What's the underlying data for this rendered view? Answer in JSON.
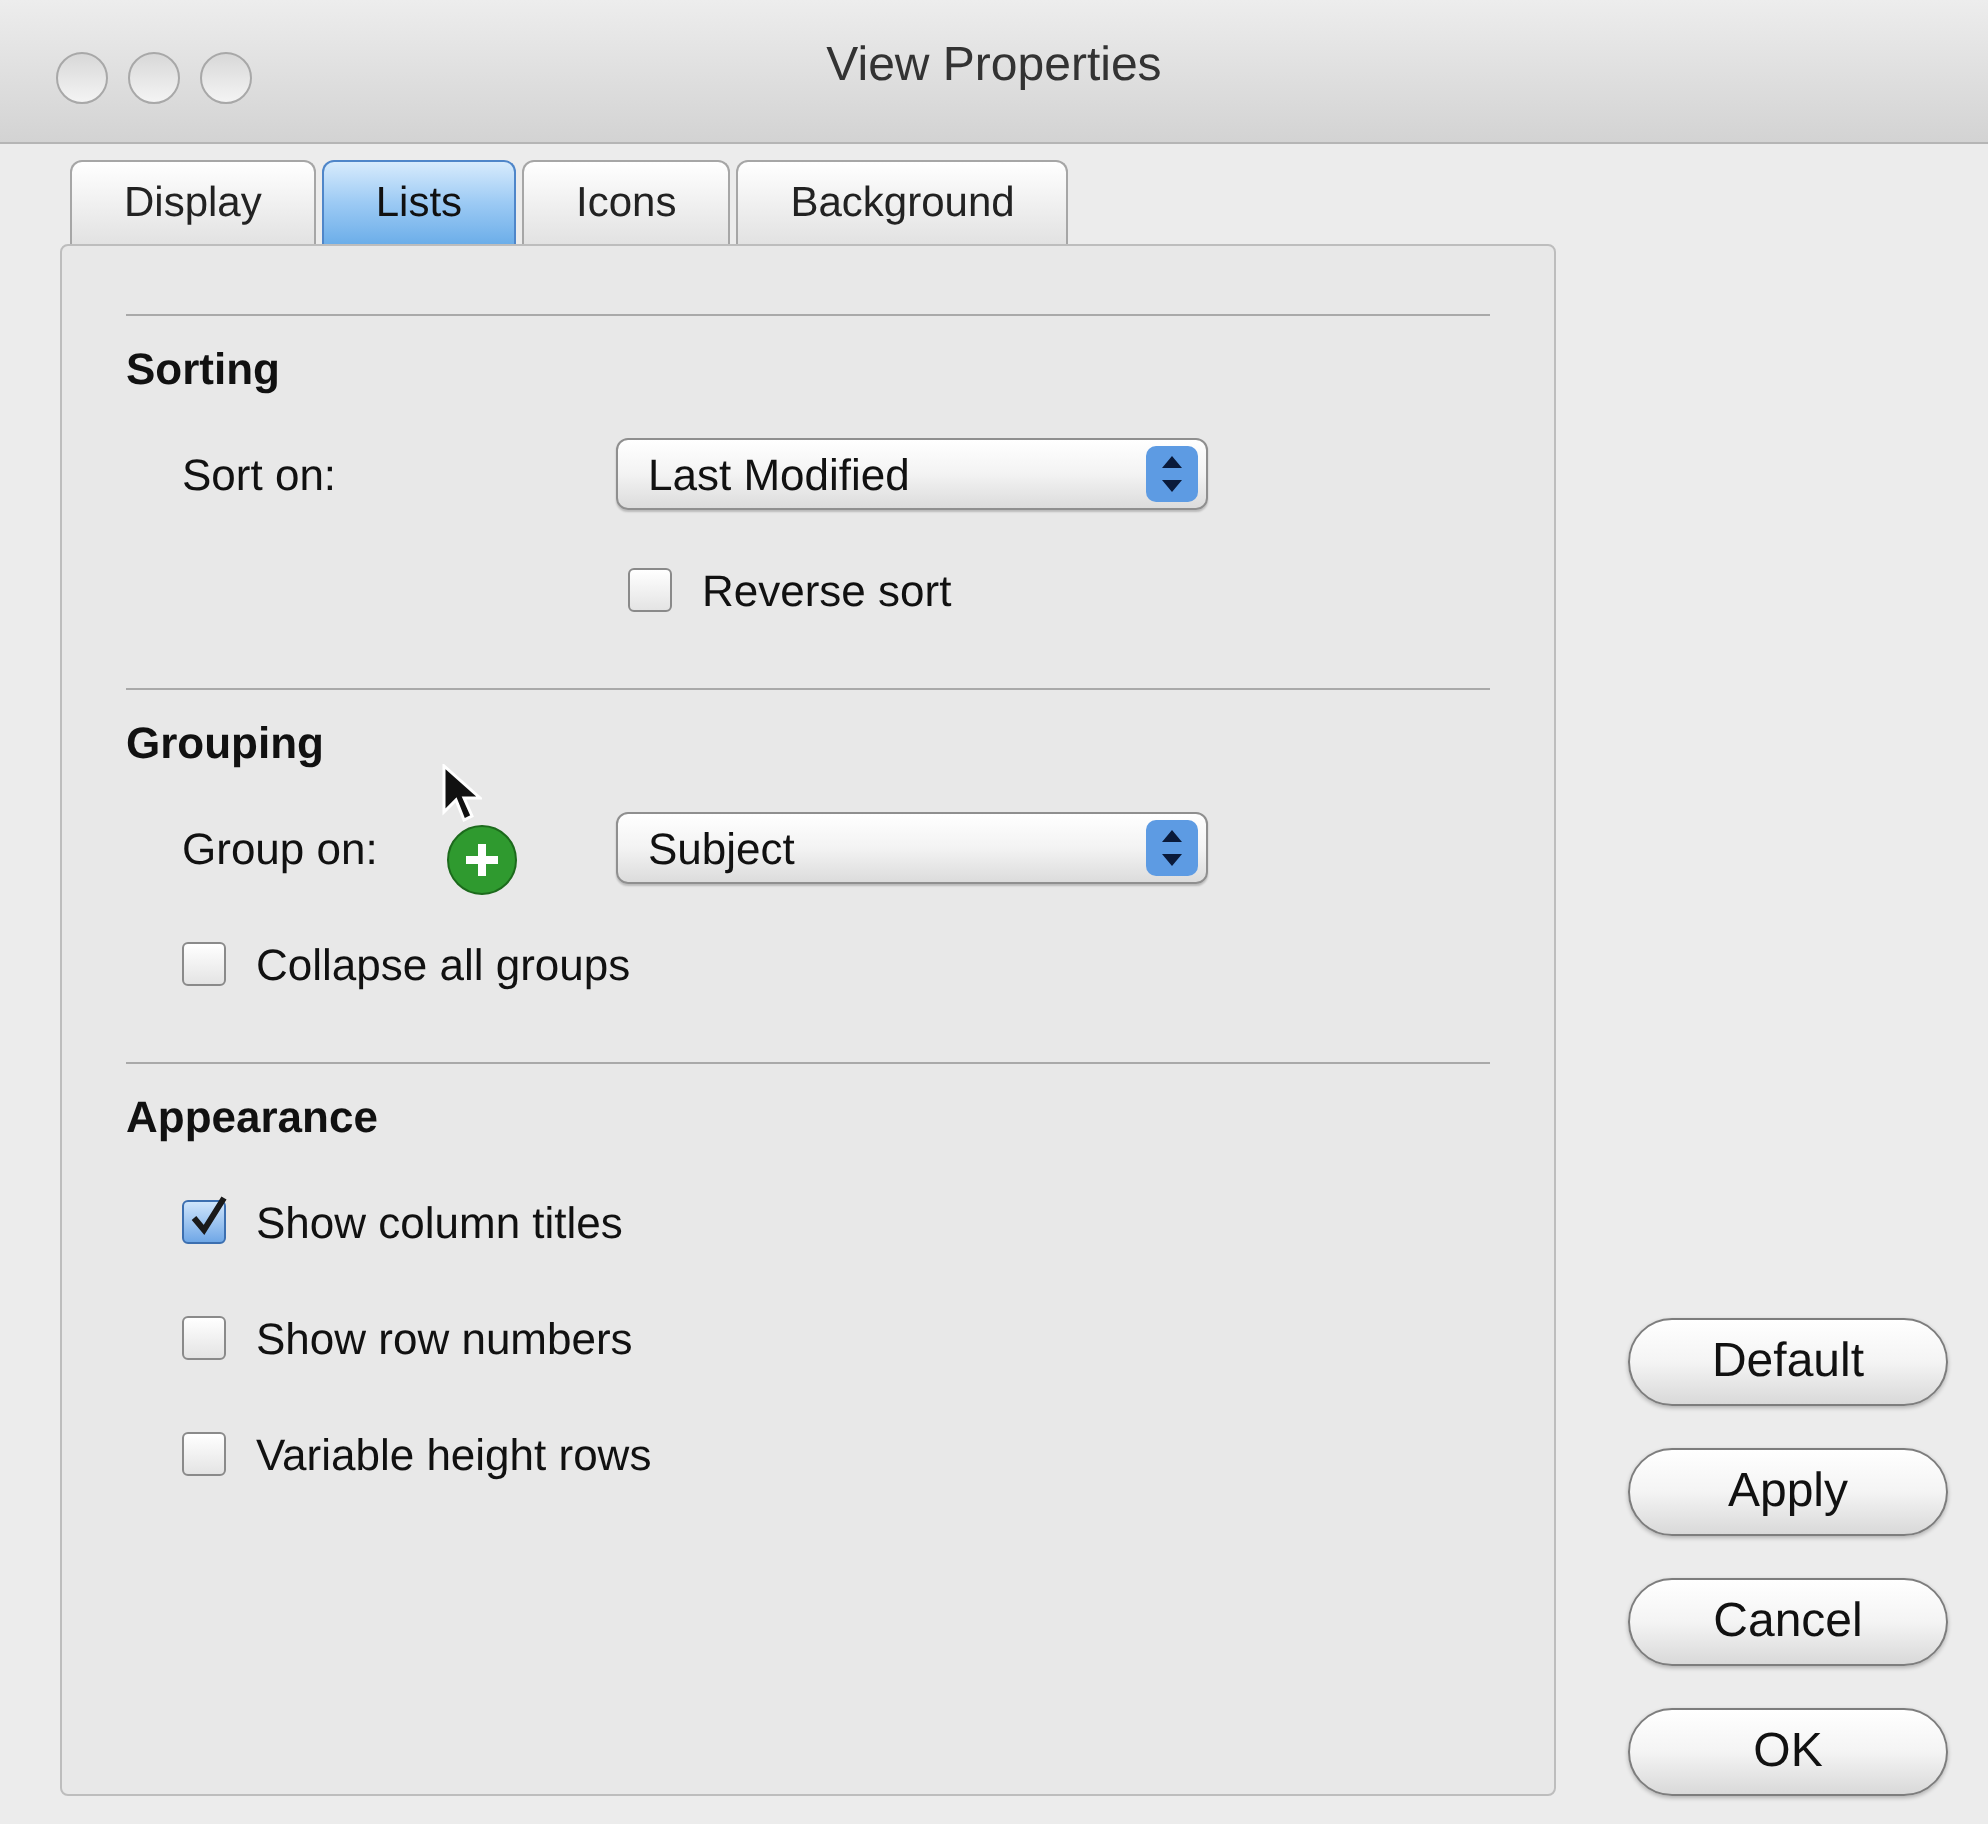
{
  "window": {
    "title": "View Properties"
  },
  "tabs": [
    {
      "label": "Display",
      "selected": false
    },
    {
      "label": "Lists",
      "selected": true
    },
    {
      "label": "Icons",
      "selected": false
    },
    {
      "label": "Background",
      "selected": false
    }
  ],
  "sections": [
    {
      "title": "Sorting",
      "rows": [
        {
          "kind": "select",
          "label": "Sort on:",
          "value": "Last Modified",
          "dragging": false
        },
        {
          "kind": "option-checkbox",
          "label": "Reverse sort",
          "checked": false
        }
      ]
    },
    {
      "title": "Grouping",
      "rows": [
        {
          "kind": "select",
          "label": "Group on:",
          "value": "Subject",
          "dragging": true
        },
        {
          "kind": "checkbox",
          "label": "Collapse all groups",
          "checked": false
        }
      ]
    },
    {
      "title": "Appearance",
      "rows": [
        {
          "kind": "checkbox",
          "label": "Show column titles",
          "checked": true
        },
        {
          "kind": "checkbox",
          "label": "Show row numbers",
          "checked": false
        },
        {
          "kind": "checkbox",
          "label": "Variable height rows",
          "checked": false
        }
      ]
    }
  ],
  "buttons": [
    "Default",
    "Apply",
    "Cancel",
    "OK"
  ]
}
